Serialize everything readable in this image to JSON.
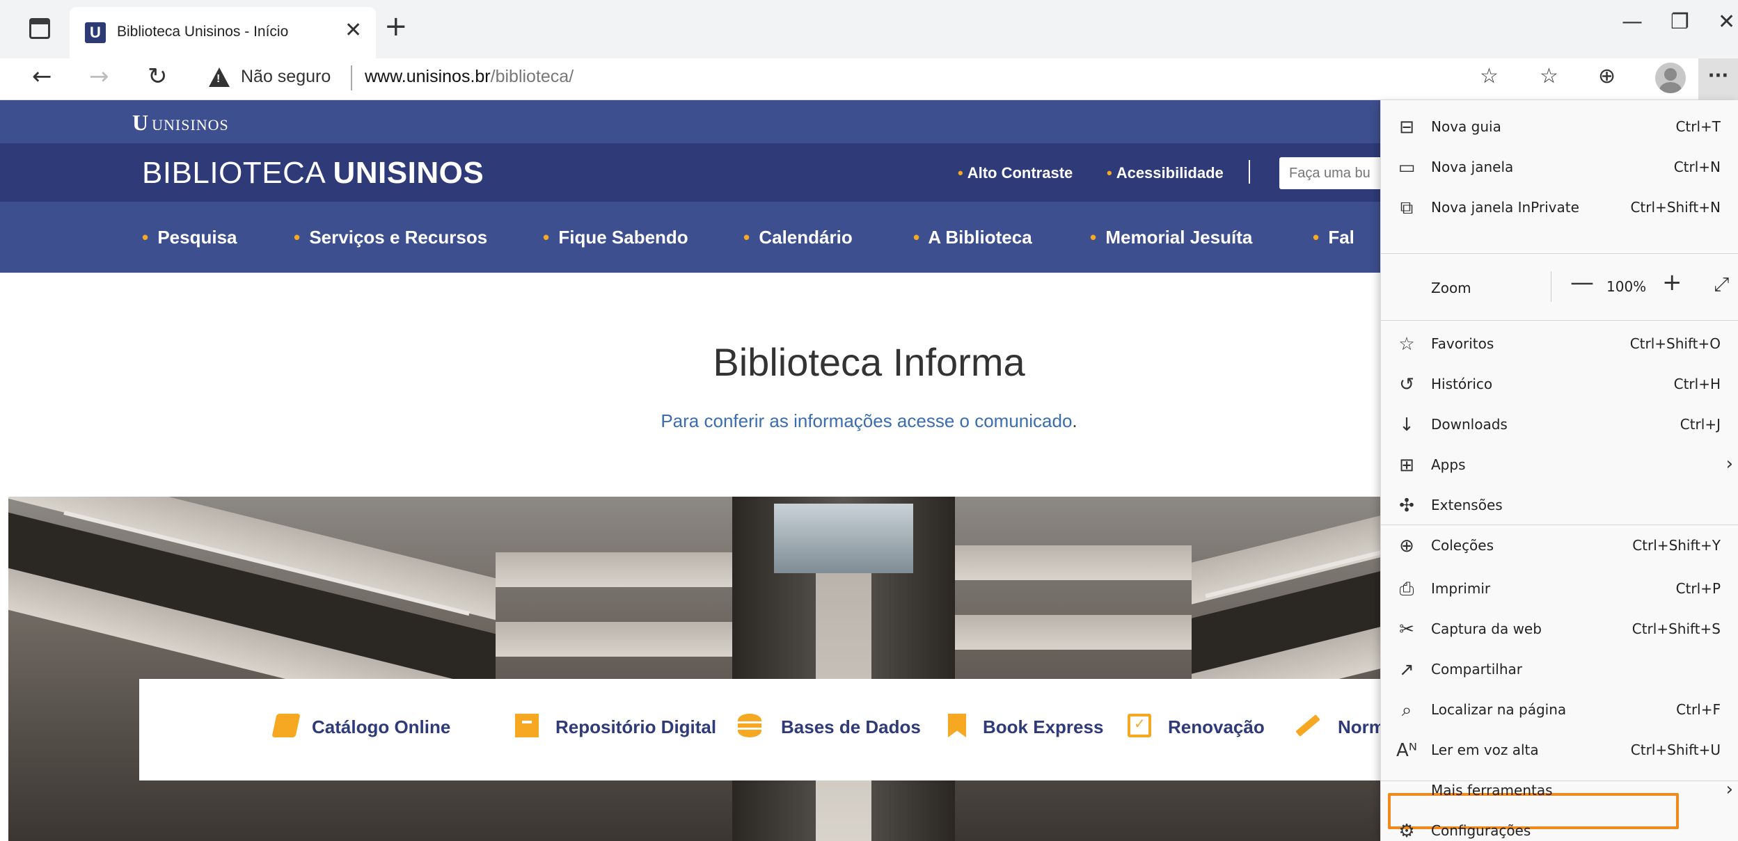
{
  "browser": {
    "tab_title": "Biblioteca Unisinos - Início",
    "favicon_letter": "U",
    "not_secure": "Não seguro",
    "url_host": "www.unisinos.br",
    "url_path": "/biblioteca/"
  },
  "site": {
    "logo_text": "UNISINOS",
    "brand_light": "BIBLIOTECA ",
    "brand_bold": "UNISINOS",
    "util_links": [
      "Alto Contraste",
      "Acessibilidade"
    ],
    "search_placeholder": "Faça uma bu",
    "nav": [
      "Pesquisa",
      "Serviços e Recursos",
      "Fique Sabendo",
      "Calendário",
      "A Biblioteca",
      "Memorial Jesuíta",
      "Fal"
    ],
    "title": "Biblioteca Informa",
    "subtitle": "Para conferir as informações acesse o comunicado",
    "subtitle_end": ".",
    "quick_links": [
      "Catálogo Online",
      "Repositório Digital",
      "Bases de Dados",
      "Book Express",
      "Renovação",
      "Norm"
    ],
    "accent_color": "#f7a823",
    "primary_color": "#2f3b78"
  },
  "menu": {
    "items": [
      {
        "label": "Nova guia",
        "shortcut": "Ctrl+T",
        "icon": "new-tab-icon",
        "glyph": "⊟"
      },
      {
        "label": "Nova janela",
        "shortcut": "Ctrl+N",
        "icon": "new-window-icon",
        "glyph": "▭"
      },
      {
        "label": "Nova janela InPrivate",
        "shortcut": "Ctrl+Shift+N",
        "icon": "inprivate-icon",
        "glyph": "⧉"
      },
      {
        "label": "Favoritos",
        "shortcut": "Ctrl+Shift+O",
        "icon": "favorites-icon",
        "glyph": "☆"
      },
      {
        "label": "Histórico",
        "shortcut": "Ctrl+H",
        "icon": "history-icon",
        "glyph": "↺"
      },
      {
        "label": "Downloads",
        "shortcut": "Ctrl+J",
        "icon": "download-icon",
        "glyph": "↓"
      },
      {
        "label": "Apps",
        "shortcut": "",
        "icon": "apps-icon",
        "glyph": "⊞"
      },
      {
        "label": "Extensões",
        "shortcut": "",
        "icon": "extensions-icon",
        "glyph": "✣"
      },
      {
        "label": "Coleções",
        "shortcut": "Ctrl+Shift+Y",
        "icon": "collections-icon",
        "glyph": "⊕"
      },
      {
        "label": "Imprimir",
        "shortcut": "Ctrl+P",
        "icon": "print-icon",
        "glyph": "⎙"
      },
      {
        "label": "Captura da web",
        "shortcut": "Ctrl+Shift+S",
        "icon": "web-capture-icon",
        "glyph": "✂"
      },
      {
        "label": "Compartilhar",
        "shortcut": "",
        "icon": "share-icon",
        "glyph": "↗"
      },
      {
        "label": "Localizar na página",
        "shortcut": "Ctrl+F",
        "icon": "find-icon",
        "glyph": "⌕"
      },
      {
        "label": "Ler em voz alta",
        "shortcut": "Ctrl+Shift+U",
        "icon": "read-aloud-icon",
        "glyph": "Aᴺ"
      },
      {
        "label": "Mais ferramentas",
        "shortcut": "",
        "icon": "",
        "glyph": ""
      },
      {
        "label": "Configurações",
        "shortcut": "",
        "icon": "gear-icon",
        "glyph": "⚙"
      }
    ],
    "zoom_label": "Zoom",
    "zoom_value": "100%",
    "highlight_color": "#f08a1c"
  }
}
